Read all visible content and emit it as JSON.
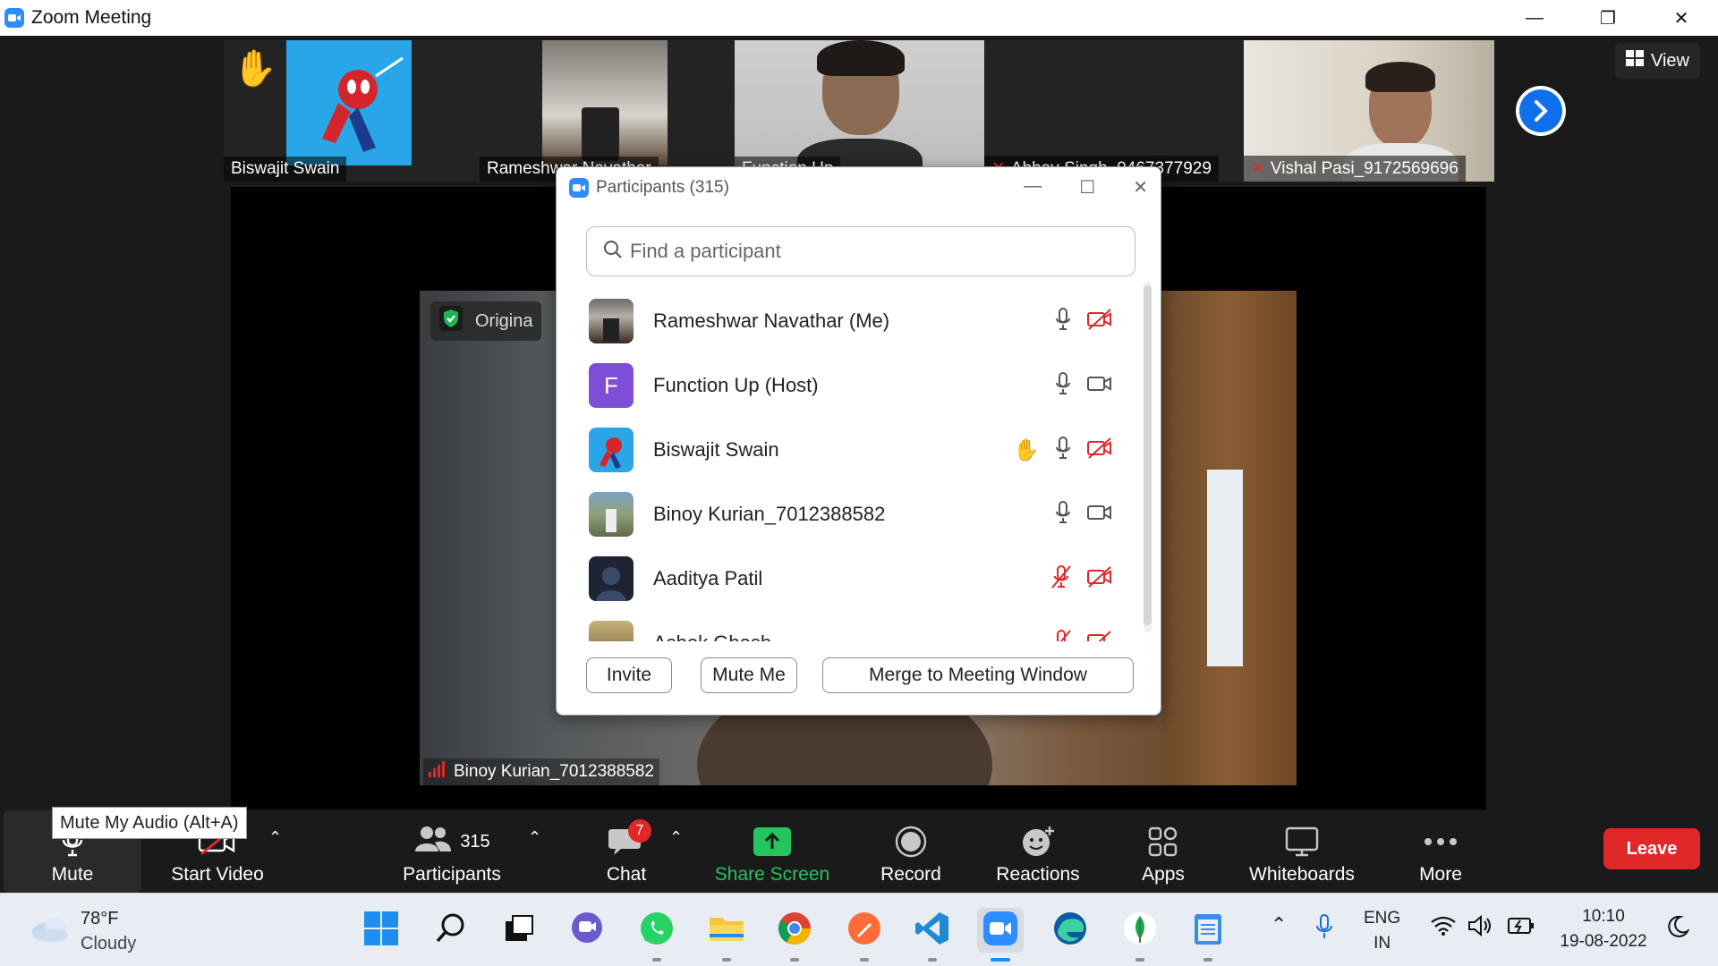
{
  "window": {
    "title": "Zoom Meeting",
    "minimize": "—",
    "restore": "❐",
    "close": "✕"
  },
  "view": {
    "label": "View"
  },
  "thumbnails": [
    {
      "name": "Biswajit Swain"
    },
    {
      "name": "Rameshwar Navathar"
    },
    {
      "name": "Function Up"
    },
    {
      "name": "Abhay Singh_9467377929"
    },
    {
      "name": "Vishal Pasi_9172569696"
    }
  ],
  "speaker": {
    "name": "Binoy Kurian_7012388582",
    "badge": "Origina"
  },
  "participants_panel": {
    "title": "Participants (315)",
    "search_placeholder": "Find a participant",
    "rows": [
      {
        "name": "Rameshwar Navathar (Me)",
        "avatar": "photo",
        "hand": false,
        "mic": "on",
        "video": "off"
      },
      {
        "name": "Function Up (Host)",
        "avatar": "F",
        "avatar_color": "#7e4fd6",
        "hand": false,
        "mic": "on",
        "video": "on"
      },
      {
        "name": "Biswajit Swain",
        "avatar": "spider",
        "hand": true,
        "mic": "on",
        "video": "off"
      },
      {
        "name": "Binoy Kurian_7012388582",
        "avatar": "photo",
        "hand": false,
        "mic": "on",
        "video": "on"
      },
      {
        "name": "Aaditya Patil",
        "avatar": "dark",
        "hand": false,
        "mic": "off",
        "video": "off"
      },
      {
        "name": "Ashok Ghosh",
        "avatar": "photo",
        "hand": false,
        "mic": "off",
        "video": "off"
      }
    ],
    "buttons": {
      "invite": "Invite",
      "mute_me": "Mute Me",
      "merge": "Merge to Meeting Window"
    }
  },
  "toolbar": {
    "mute": "Mute",
    "start_video": "Start Video",
    "participants": "Participants",
    "participants_count": "315",
    "chat": "Chat",
    "chat_badge": "7",
    "share_screen": "Share Screen",
    "record": "Record",
    "reactions": "Reactions",
    "apps": "Apps",
    "whiteboards": "Whiteboards",
    "more": "More",
    "leave": "Leave",
    "tooltip": "Mute My Audio (Alt+A)"
  },
  "taskbar": {
    "weather_temp": "78°F",
    "weather_desc": "Cloudy",
    "lang_top": "ENG",
    "lang_bottom": "IN",
    "time": "10:10",
    "date": "19-08-2022"
  },
  "colors": {
    "zoom_blue": "#2d8cff",
    "leave_red": "#e02828",
    "share_green": "#22c55e",
    "muted_red": "#e02828"
  }
}
